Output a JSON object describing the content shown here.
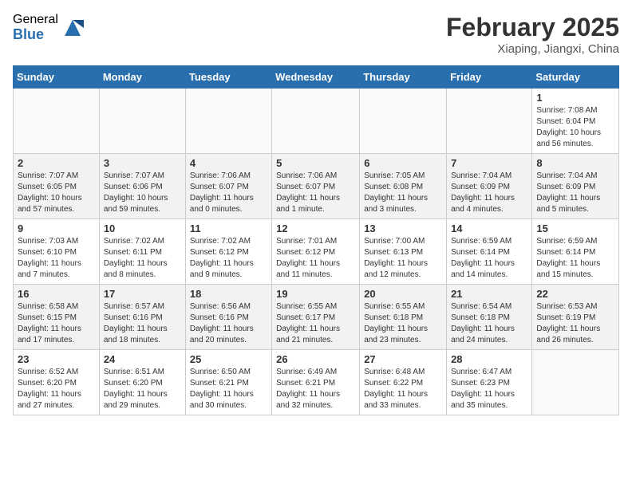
{
  "header": {
    "logo_general": "General",
    "logo_blue": "Blue",
    "title": "February 2025",
    "location": "Xiaping, Jiangxi, China"
  },
  "weekdays": [
    "Sunday",
    "Monday",
    "Tuesday",
    "Wednesday",
    "Thursday",
    "Friday",
    "Saturday"
  ],
  "weeks": [
    [
      {
        "day": "",
        "info": ""
      },
      {
        "day": "",
        "info": ""
      },
      {
        "day": "",
        "info": ""
      },
      {
        "day": "",
        "info": ""
      },
      {
        "day": "",
        "info": ""
      },
      {
        "day": "",
        "info": ""
      },
      {
        "day": "1",
        "info": "Sunrise: 7:08 AM\nSunset: 6:04 PM\nDaylight: 10 hours\nand 56 minutes."
      }
    ],
    [
      {
        "day": "2",
        "info": "Sunrise: 7:07 AM\nSunset: 6:05 PM\nDaylight: 10 hours\nand 57 minutes."
      },
      {
        "day": "3",
        "info": "Sunrise: 7:07 AM\nSunset: 6:06 PM\nDaylight: 10 hours\nand 59 minutes."
      },
      {
        "day": "4",
        "info": "Sunrise: 7:06 AM\nSunset: 6:07 PM\nDaylight: 11 hours\nand 0 minutes."
      },
      {
        "day": "5",
        "info": "Sunrise: 7:06 AM\nSunset: 6:07 PM\nDaylight: 11 hours\nand 1 minute."
      },
      {
        "day": "6",
        "info": "Sunrise: 7:05 AM\nSunset: 6:08 PM\nDaylight: 11 hours\nand 3 minutes."
      },
      {
        "day": "7",
        "info": "Sunrise: 7:04 AM\nSunset: 6:09 PM\nDaylight: 11 hours\nand 4 minutes."
      },
      {
        "day": "8",
        "info": "Sunrise: 7:04 AM\nSunset: 6:09 PM\nDaylight: 11 hours\nand 5 minutes."
      }
    ],
    [
      {
        "day": "9",
        "info": "Sunrise: 7:03 AM\nSunset: 6:10 PM\nDaylight: 11 hours\nand 7 minutes."
      },
      {
        "day": "10",
        "info": "Sunrise: 7:02 AM\nSunset: 6:11 PM\nDaylight: 11 hours\nand 8 minutes."
      },
      {
        "day": "11",
        "info": "Sunrise: 7:02 AM\nSunset: 6:12 PM\nDaylight: 11 hours\nand 9 minutes."
      },
      {
        "day": "12",
        "info": "Sunrise: 7:01 AM\nSunset: 6:12 PM\nDaylight: 11 hours\nand 11 minutes."
      },
      {
        "day": "13",
        "info": "Sunrise: 7:00 AM\nSunset: 6:13 PM\nDaylight: 11 hours\nand 12 minutes."
      },
      {
        "day": "14",
        "info": "Sunrise: 6:59 AM\nSunset: 6:14 PM\nDaylight: 11 hours\nand 14 minutes."
      },
      {
        "day": "15",
        "info": "Sunrise: 6:59 AM\nSunset: 6:14 PM\nDaylight: 11 hours\nand 15 minutes."
      }
    ],
    [
      {
        "day": "16",
        "info": "Sunrise: 6:58 AM\nSunset: 6:15 PM\nDaylight: 11 hours\nand 17 minutes."
      },
      {
        "day": "17",
        "info": "Sunrise: 6:57 AM\nSunset: 6:16 PM\nDaylight: 11 hours\nand 18 minutes."
      },
      {
        "day": "18",
        "info": "Sunrise: 6:56 AM\nSunset: 6:16 PM\nDaylight: 11 hours\nand 20 minutes."
      },
      {
        "day": "19",
        "info": "Sunrise: 6:55 AM\nSunset: 6:17 PM\nDaylight: 11 hours\nand 21 minutes."
      },
      {
        "day": "20",
        "info": "Sunrise: 6:55 AM\nSunset: 6:18 PM\nDaylight: 11 hours\nand 23 minutes."
      },
      {
        "day": "21",
        "info": "Sunrise: 6:54 AM\nSunset: 6:18 PM\nDaylight: 11 hours\nand 24 minutes."
      },
      {
        "day": "22",
        "info": "Sunrise: 6:53 AM\nSunset: 6:19 PM\nDaylight: 11 hours\nand 26 minutes."
      }
    ],
    [
      {
        "day": "23",
        "info": "Sunrise: 6:52 AM\nSunset: 6:20 PM\nDaylight: 11 hours\nand 27 minutes."
      },
      {
        "day": "24",
        "info": "Sunrise: 6:51 AM\nSunset: 6:20 PM\nDaylight: 11 hours\nand 29 minutes."
      },
      {
        "day": "25",
        "info": "Sunrise: 6:50 AM\nSunset: 6:21 PM\nDaylight: 11 hours\nand 30 minutes."
      },
      {
        "day": "26",
        "info": "Sunrise: 6:49 AM\nSunset: 6:21 PM\nDaylight: 11 hours\nand 32 minutes."
      },
      {
        "day": "27",
        "info": "Sunrise: 6:48 AM\nSunset: 6:22 PM\nDaylight: 11 hours\nand 33 minutes."
      },
      {
        "day": "28",
        "info": "Sunrise: 6:47 AM\nSunset: 6:23 PM\nDaylight: 11 hours\nand 35 minutes."
      },
      {
        "day": "",
        "info": ""
      }
    ]
  ]
}
